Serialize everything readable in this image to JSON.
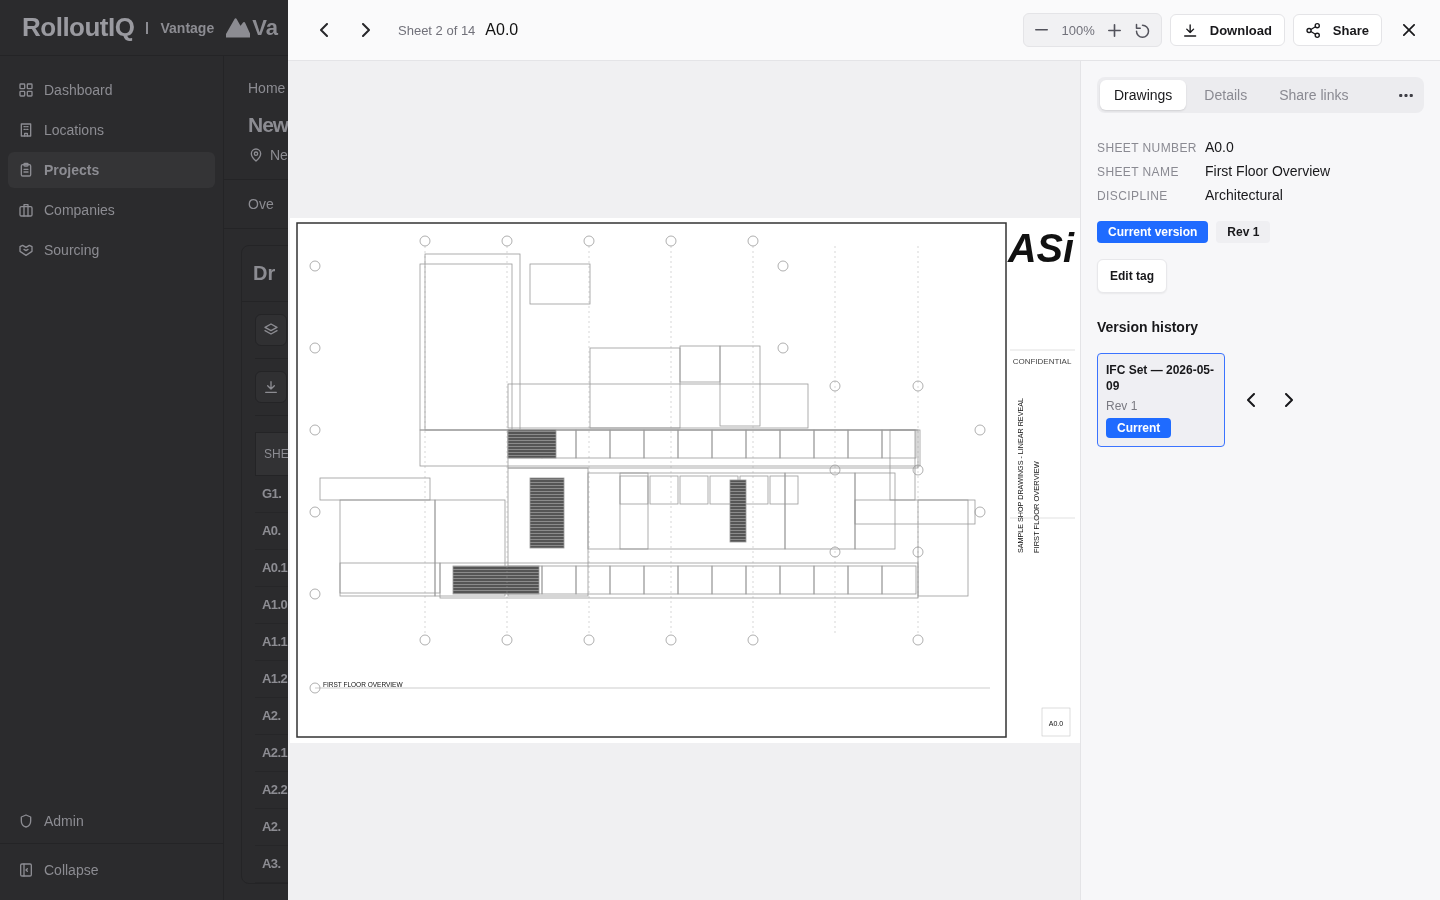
{
  "app": {
    "logo": "RolloutIQ",
    "workspace": "Vantage",
    "brand_cut": "Va",
    "nav": [
      {
        "label": "Dashboard",
        "selected": false
      },
      {
        "label": "Locations",
        "selected": false
      },
      {
        "label": "Projects",
        "selected": true
      },
      {
        "label": "Companies",
        "selected": false
      },
      {
        "label": "Sourcing",
        "selected": false
      }
    ],
    "admin": "Admin",
    "collapse": "Collapse",
    "breadcrumb": "Home",
    "title_cut": "New",
    "location_cut": "Ne",
    "tab_cut": "Ove",
    "section_cut": "Dr",
    "column_cut": "SHE",
    "rows": [
      "G1.",
      "A0.",
      "A0.1",
      "A1.0",
      "A1.1",
      "A1.2",
      "A2.",
      "A2.1",
      "A2.2",
      "A2.",
      "A3."
    ]
  },
  "viewer": {
    "sheet_position": "Sheet 2 of 14",
    "sheet_code": "A0.0",
    "zoom": "100%",
    "buttons": [
      {
        "label": "Download",
        "kind": "download"
      },
      {
        "label": "Share",
        "kind": "share"
      }
    ]
  },
  "sheet": {
    "logo": "ASi",
    "notice": "CONFIDENTIAL",
    "project": "SAMPLE SHOP DRAWINGS - LINEAR REVEAL",
    "page": "FIRST FLOOR OVERVIEW",
    "view_title": "FIRST FLOOR OVERVIEW",
    "sheet_number": "A0.0"
  },
  "panel": {
    "tabs": [
      {
        "label": "Drawings",
        "selected": true
      },
      {
        "label": "Details",
        "selected": false
      },
      {
        "label": "Share links",
        "selected": false
      }
    ],
    "fields": [
      {
        "label": "SHEET NUMBER",
        "value": "A0.0"
      },
      {
        "label": "SHEET NAME",
        "value": "First Floor Overview"
      },
      {
        "label": "DISCIPLINE",
        "value": "Architectural"
      }
    ],
    "tags": [
      {
        "label": "Current version",
        "kind": "primary"
      },
      {
        "label": "Rev 1",
        "kind": "plain"
      }
    ],
    "edit_tag": "Edit tag",
    "history_title": "Version history",
    "versions": [
      {
        "title": "IFC Set — 2026-05-09",
        "revision": "Rev 1",
        "badge": "Current",
        "selected": true
      }
    ]
  }
}
